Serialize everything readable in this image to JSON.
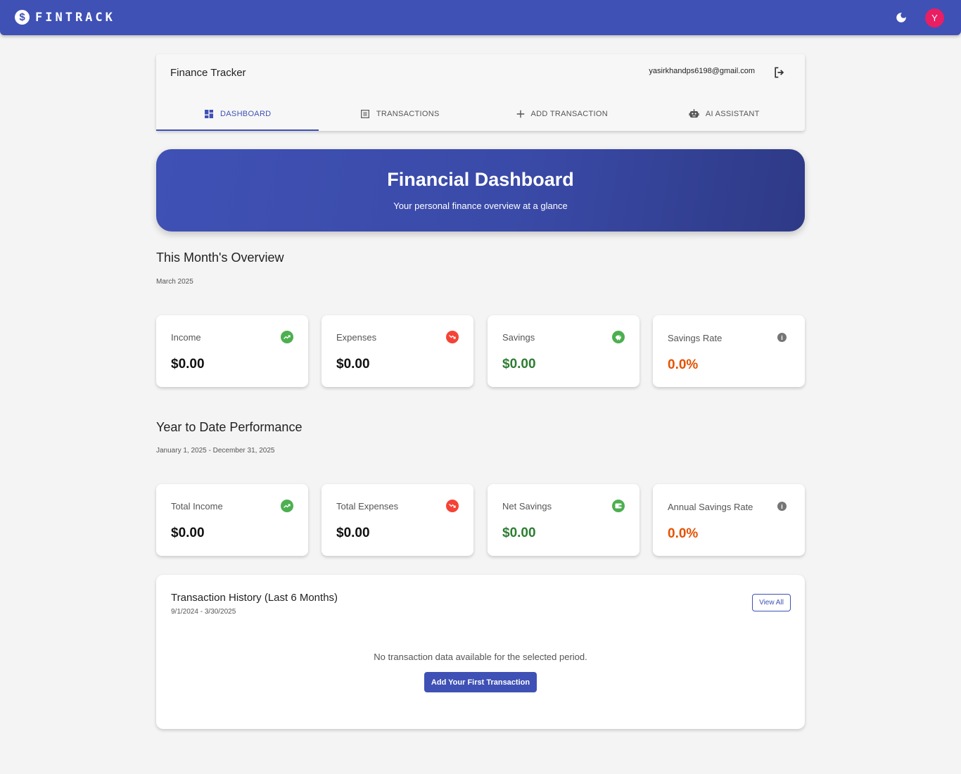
{
  "appbar": {
    "brand_glyph": "$",
    "brand": "FINTRACK",
    "theme_icon": "moon-icon",
    "avatar_initial": "Y",
    "colors": {
      "primary": "#3f51b5",
      "avatar": "#e91e63"
    }
  },
  "header": {
    "title": "Finance Tracker",
    "email": "yasirkhandps6198@gmail.com",
    "logout_icon": "logout-icon",
    "tabs": [
      {
        "label": "DASHBOARD",
        "icon": "dashboard-icon",
        "active": true
      },
      {
        "label": "TRANSACTIONS",
        "icon": "list-icon",
        "active": false
      },
      {
        "label": "ADD TRANSACTION",
        "icon": "plus-icon",
        "active": false
      },
      {
        "label": "AI ASSISTANT",
        "icon": "robot-icon",
        "active": false
      }
    ]
  },
  "hero": {
    "title": "Financial Dashboard",
    "subtitle": "Your personal finance overview at a glance"
  },
  "month": {
    "title": "This Month's Overview",
    "period": "March 2025",
    "cards": [
      {
        "label": "Income",
        "value": "$0.00",
        "icon": "trending-up-icon"
      },
      {
        "label": "Expenses",
        "value": "$0.00",
        "icon": "trending-down-icon"
      },
      {
        "label": "Savings",
        "value": "$0.00",
        "icon": "piggy-bank-icon"
      },
      {
        "label": "Savings Rate",
        "value": "0.0%",
        "icon": "info-icon"
      }
    ]
  },
  "ytd": {
    "title": "Year to Date Performance",
    "period": "January 1, 2025 - December 31, 2025",
    "cards": [
      {
        "label": "Total Income",
        "value": "$0.00",
        "icon": "trending-up-icon"
      },
      {
        "label": "Total Expenses",
        "value": "$0.00",
        "icon": "trending-down-icon"
      },
      {
        "label": "Net Savings",
        "value": "$0.00",
        "icon": "wallet-icon"
      },
      {
        "label": "Annual Savings Rate",
        "value": "0.0%",
        "icon": "info-icon"
      }
    ]
  },
  "history": {
    "title": "Transaction History (Last 6 Months)",
    "range": "9/1/2024 - 3/30/2025",
    "view_all": "View All",
    "empty_message": "No transaction data available for the selected period.",
    "add_first": "Add Your First Transaction"
  }
}
